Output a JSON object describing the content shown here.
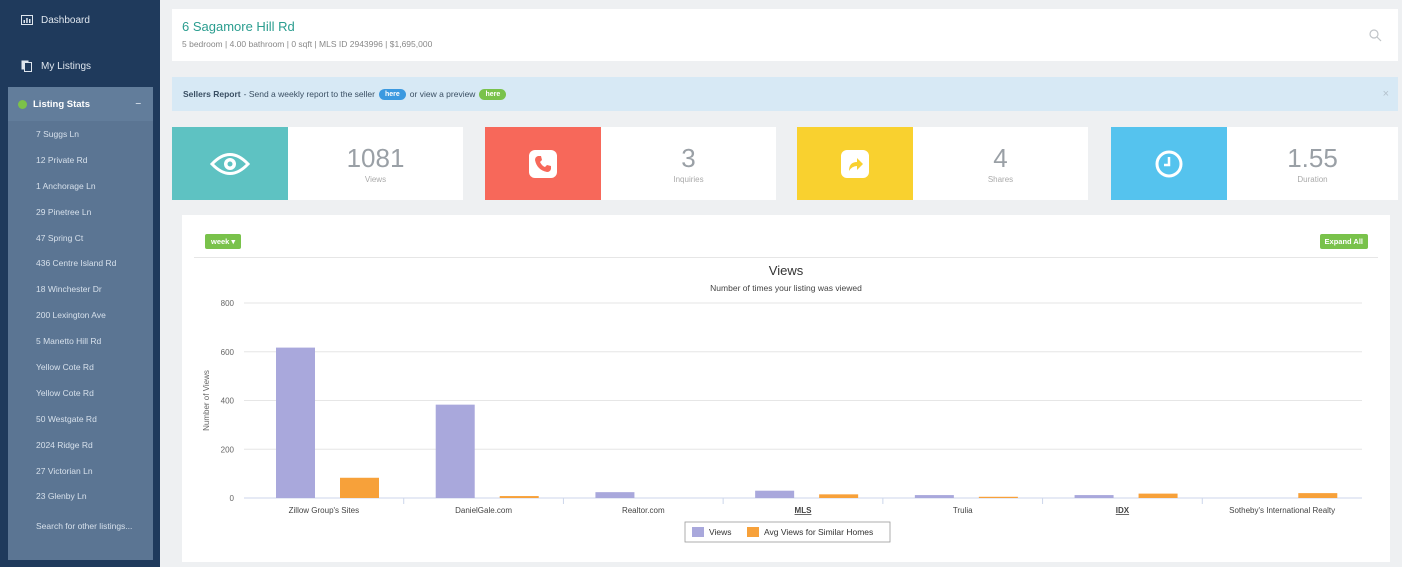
{
  "sidebar": {
    "dashboard": "Dashboard",
    "my_listings": "My Listings",
    "listing_stats": "Listing Stats",
    "collapse_symbol": "–",
    "listings": [
      "7 Suggs Ln",
      "12 Private Rd",
      "1 Anchorage Ln",
      "29 Pinetree Ln",
      "47 Spring Ct",
      "436 Centre Island Rd",
      "18 Winchester Dr",
      "200 Lexington Ave",
      "5 Manetto Hill Rd",
      "Yellow Cote Rd",
      "Yellow Cote Rd",
      "50 Westgate Rd",
      "2024 Ridge Rd",
      "27 Victorian Ln",
      "23 Glenby Ln"
    ],
    "search_other": "Search for other listings..."
  },
  "header": {
    "title": "6 Sagamore Hill Rd",
    "subtitle": "5 bedroom | 4.00 bathroom | 0 sqft | MLS ID 2943996 | $1,695,000"
  },
  "banner": {
    "bold": "Sellers Report",
    "text1": "- Send a weekly report to the seller",
    "pill1": "here",
    "text2": "or view a preview",
    "pill2": "here",
    "close": "×"
  },
  "stats": [
    {
      "value": "1081",
      "label": "Views",
      "color": "#5ec2c2",
      "icon": "eye-icon"
    },
    {
      "value": "3",
      "label": "Inquiries",
      "color": "#f7685a",
      "icon": "phone-icon"
    },
    {
      "value": "4",
      "label": "Shares",
      "color": "#f9d12f",
      "icon": "share-icon"
    },
    {
      "value": "1.55",
      "label": "Duration",
      "color": "#55c3ee",
      "icon": "clock-icon"
    }
  ],
  "controls": {
    "week": "week ▾",
    "expand_all": "Expand All"
  },
  "chart_data": {
    "type": "bar",
    "title": "Views",
    "subtitle": "Number of times your listing was viewed",
    "ylabel": "Number of Views",
    "xlabel": "",
    "ylim": [
      0,
      800
    ],
    "yticks": [
      0,
      200,
      400,
      600,
      800
    ],
    "categories": [
      "Zillow Group's Sites",
      "DanielGale.com",
      "Realtor.com",
      "MLS",
      "Trulia",
      "IDX",
      "Sotheby's International Realty"
    ],
    "underlined_categories": [
      "MLS",
      "IDX"
    ],
    "series": [
      {
        "name": "Views",
        "color": "#a9a8dc",
        "values": [
          617,
          383,
          24,
          30,
          12,
          12,
          0
        ]
      },
      {
        "name": "Avg Views for Similar Homes",
        "color": "#f7a13a",
        "values": [
          83,
          8,
          0,
          15,
          5,
          18,
          20
        ]
      }
    ],
    "legend_position": "bottom-center",
    "grid": true
  }
}
